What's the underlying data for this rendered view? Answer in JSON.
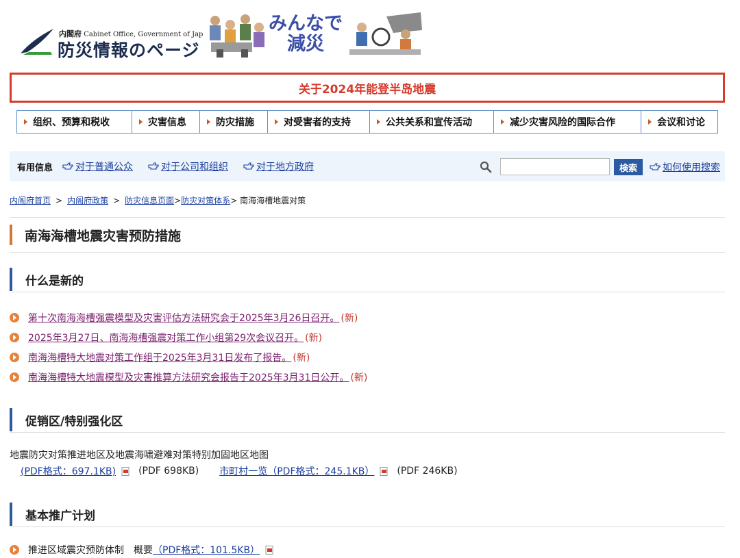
{
  "header": {
    "org_jp": "内閣府",
    "org_en": "Cabinet Office, Government of Japan",
    "site_title": "防災情報のページ",
    "slogan_line1": "みんなで",
    "slogan_line2": "減災"
  },
  "alert": {
    "label": "关于2024年能登半岛地震"
  },
  "gnav": {
    "items": [
      {
        "label": "组织、预算和税收"
      },
      {
        "label": "灾害信息"
      },
      {
        "label": "防灾措施"
      },
      {
        "label": "对受害者的支持"
      },
      {
        "label": "公共关系和宣传活动"
      },
      {
        "label": "减少灾害风险的国际合作"
      },
      {
        "label": "会议和讨论"
      }
    ]
  },
  "util": {
    "label": "有用信息",
    "links": [
      {
        "label": "对于普通公众"
      },
      {
        "label": "对于公司和组织"
      },
      {
        "label": "对于地方政府"
      }
    ],
    "search_value": "",
    "search_button": "検索",
    "help_link": "如何使用搜索"
  },
  "breadcrumb": {
    "items": [
      {
        "label": "内阁府首页"
      },
      {
        "label": "内阁府政策"
      },
      {
        "label": "防灾信息页面"
      },
      {
        "label": "防灾对策体系"
      }
    ],
    "sep": ">",
    "current": "> 南海海槽地震对策"
  },
  "page_title": "南海海槽地震灾害预防措施",
  "news": {
    "heading": "什么是新的",
    "items": [
      {
        "label": "第十次南海海槽强震模型及灾害评估方法研究会于2025年3月26日召开。",
        "tag": "(新)"
      },
      {
        "label": "2025年3月27日、南海海槽强震对策工作小组第29次会议召开。",
        "tag": "(新)"
      },
      {
        "label": "南海海槽特大地震对策工作组于2025年3月31日发布了报告。",
        "tag": "(新)"
      },
      {
        "label": "南海海槽特大地震模型及灾害推算方法研究会报告于2025年3月31日公开。",
        "tag": "(新)"
      }
    ]
  },
  "pref": {
    "heading": "促销区/特别强化区",
    "text": "地震防灾对策推进地区及地震海啸避难对策特别加固地区地图",
    "link1": "(PDF格式：697.1KB)",
    "size1": "(PDF 698KB)",
    "link2": "市町村一览（PDF格式：245.1KB）",
    "size2": "(PDF 246KB)"
  },
  "plan": {
    "heading": "基本推广计划",
    "text": "推进区域震灾预防体制　概要",
    "link": "（PDF格式：101.5KB）"
  },
  "colors": {
    "alert_red": "#d33b2c",
    "nav_border": "#5b8cc8",
    "title_bar": "#d1793a",
    "section_bar": "#2d5b9b",
    "bullet": "#e8823a",
    "visited_link": "#7a1f6e",
    "new_tag": "#c0392b",
    "search_button": "#2c5aa0"
  }
}
